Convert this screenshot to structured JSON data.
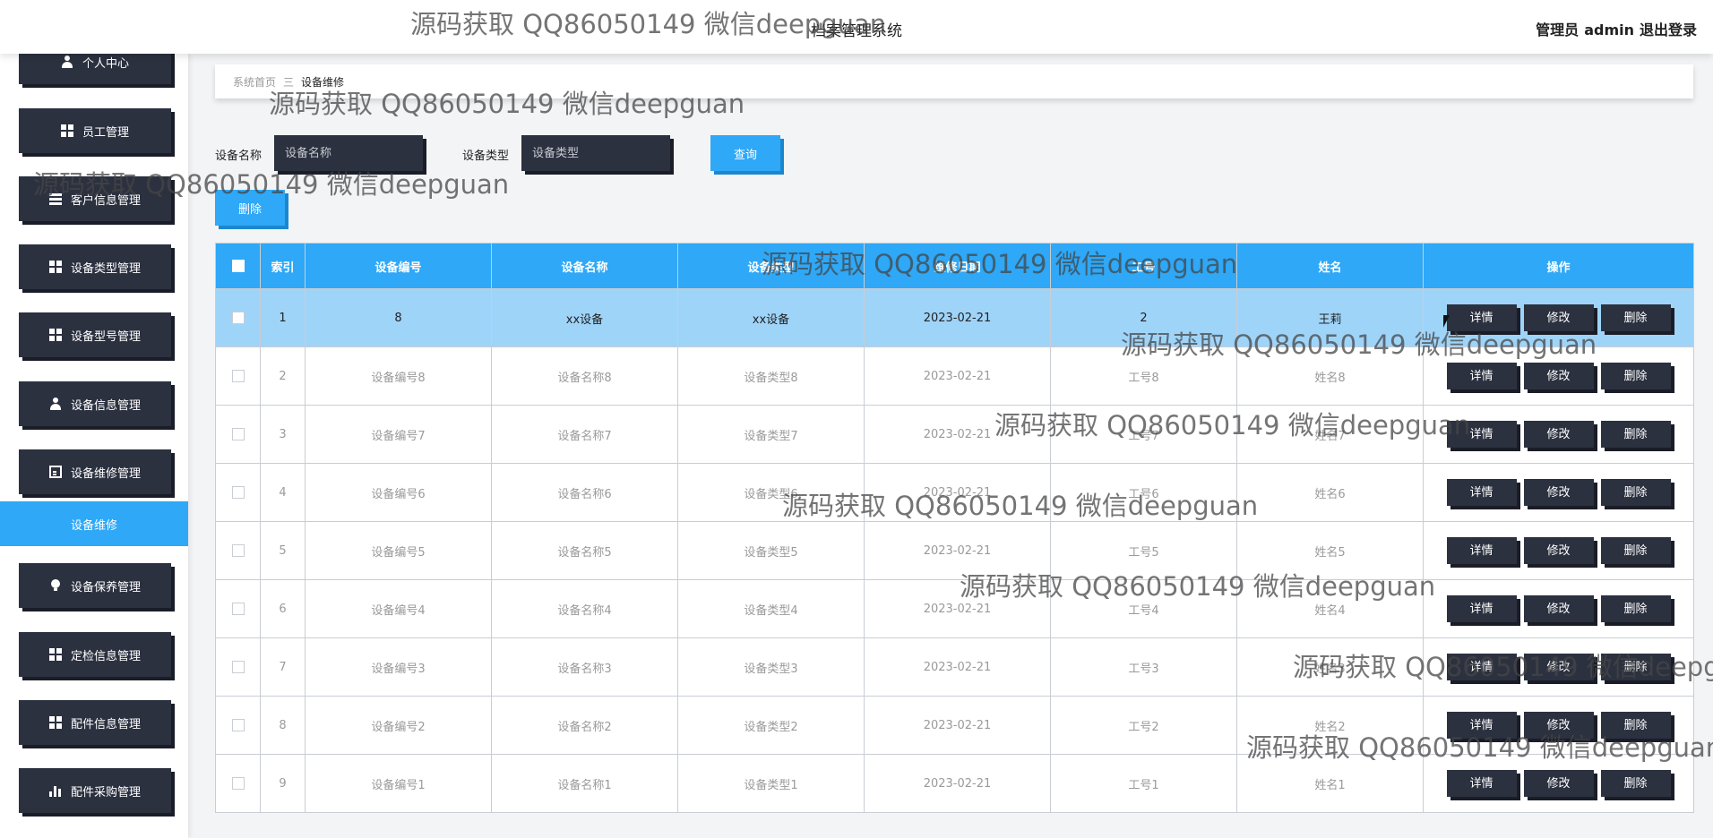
{
  "header": {
    "title": "档案管理系统",
    "user_label": "管理员",
    "user_name": "admin",
    "logout": "退出登录"
  },
  "sidebar": {
    "items": [
      {
        "label": "个人中心",
        "icon": "user-icon"
      },
      {
        "label": "员工管理",
        "icon": "grid-icon"
      },
      {
        "label": "客户信息管理",
        "icon": "table-icon"
      },
      {
        "label": "设备类型管理",
        "icon": "grid-icon"
      },
      {
        "label": "设备型号管理",
        "icon": "grid-icon"
      },
      {
        "label": "设备信息管理",
        "icon": "user-icon"
      },
      {
        "label": "设备维修管理",
        "icon": "clipboard-icon"
      },
      {
        "label": "设备保养管理",
        "icon": "bulb-icon"
      },
      {
        "label": "定检信息管理",
        "icon": "grid-icon"
      },
      {
        "label": "配件信息管理",
        "icon": "grid-icon"
      },
      {
        "label": "配件采购管理",
        "icon": "bar-chart-icon"
      }
    ],
    "active_sub": "设备维修"
  },
  "breadcrumb": {
    "home": "系统首页",
    "sep": "三",
    "current": "设备维修"
  },
  "search": {
    "name_label": "设备名称",
    "name_placeholder": "设备名称",
    "type_label": "设备类型",
    "type_placeholder": "设备类型",
    "query_button": "查询",
    "delete_button": "删除"
  },
  "table": {
    "columns": [
      "索引",
      "设备编号",
      "设备名称",
      "设备类型",
      "维修日期",
      "工号",
      "姓名",
      "操作"
    ],
    "actions": {
      "detail": "详情",
      "edit": "修改",
      "delete": "删除"
    },
    "rows": [
      {
        "index": "1",
        "code": "8",
        "name": "xx设备",
        "type": "xx设备",
        "date": "2023-02-21",
        "emp_no": "2",
        "emp_name": "王莉"
      },
      {
        "index": "2",
        "code": "设备编号8",
        "name": "设备名称8",
        "type": "设备类型8",
        "date": "2023-02-21",
        "emp_no": "工号8",
        "emp_name": "姓名8"
      },
      {
        "index": "3",
        "code": "设备编号7",
        "name": "设备名称7",
        "type": "设备类型7",
        "date": "2023-02-21",
        "emp_no": "工号7",
        "emp_name": "姓名7"
      },
      {
        "index": "4",
        "code": "设备编号6",
        "name": "设备名称6",
        "type": "设备类型6",
        "date": "2023-02-21",
        "emp_no": "工号6",
        "emp_name": "姓名6"
      },
      {
        "index": "5",
        "code": "设备编号5",
        "name": "设备名称5",
        "type": "设备类型5",
        "date": "2023-02-21",
        "emp_no": "工号5",
        "emp_name": "姓名5"
      },
      {
        "index": "6",
        "code": "设备编号4",
        "name": "设备名称4",
        "type": "设备类型4",
        "date": "2023-02-21",
        "emp_no": "工号4",
        "emp_name": "姓名4"
      },
      {
        "index": "7",
        "code": "设备编号3",
        "name": "设备名称3",
        "type": "设备类型3",
        "date": "2023-02-21",
        "emp_no": "工号3",
        "emp_name": "姓名3"
      },
      {
        "index": "8",
        "code": "设备编号2",
        "name": "设备名称2",
        "type": "设备类型2",
        "date": "2023-02-21",
        "emp_no": "工号2",
        "emp_name": "姓名2"
      },
      {
        "index": "9",
        "code": "设备编号1",
        "name": "设备名称1",
        "type": "设备类型1",
        "date": "2023-02-21",
        "emp_no": "工号1",
        "emp_name": "姓名1"
      }
    ]
  },
  "watermark": "源码获取 QQ86050149 微信deepguan",
  "colors": {
    "accent": "#2ea8f7",
    "dark": "#2c3140",
    "selected_row": "#9fd4f9"
  }
}
